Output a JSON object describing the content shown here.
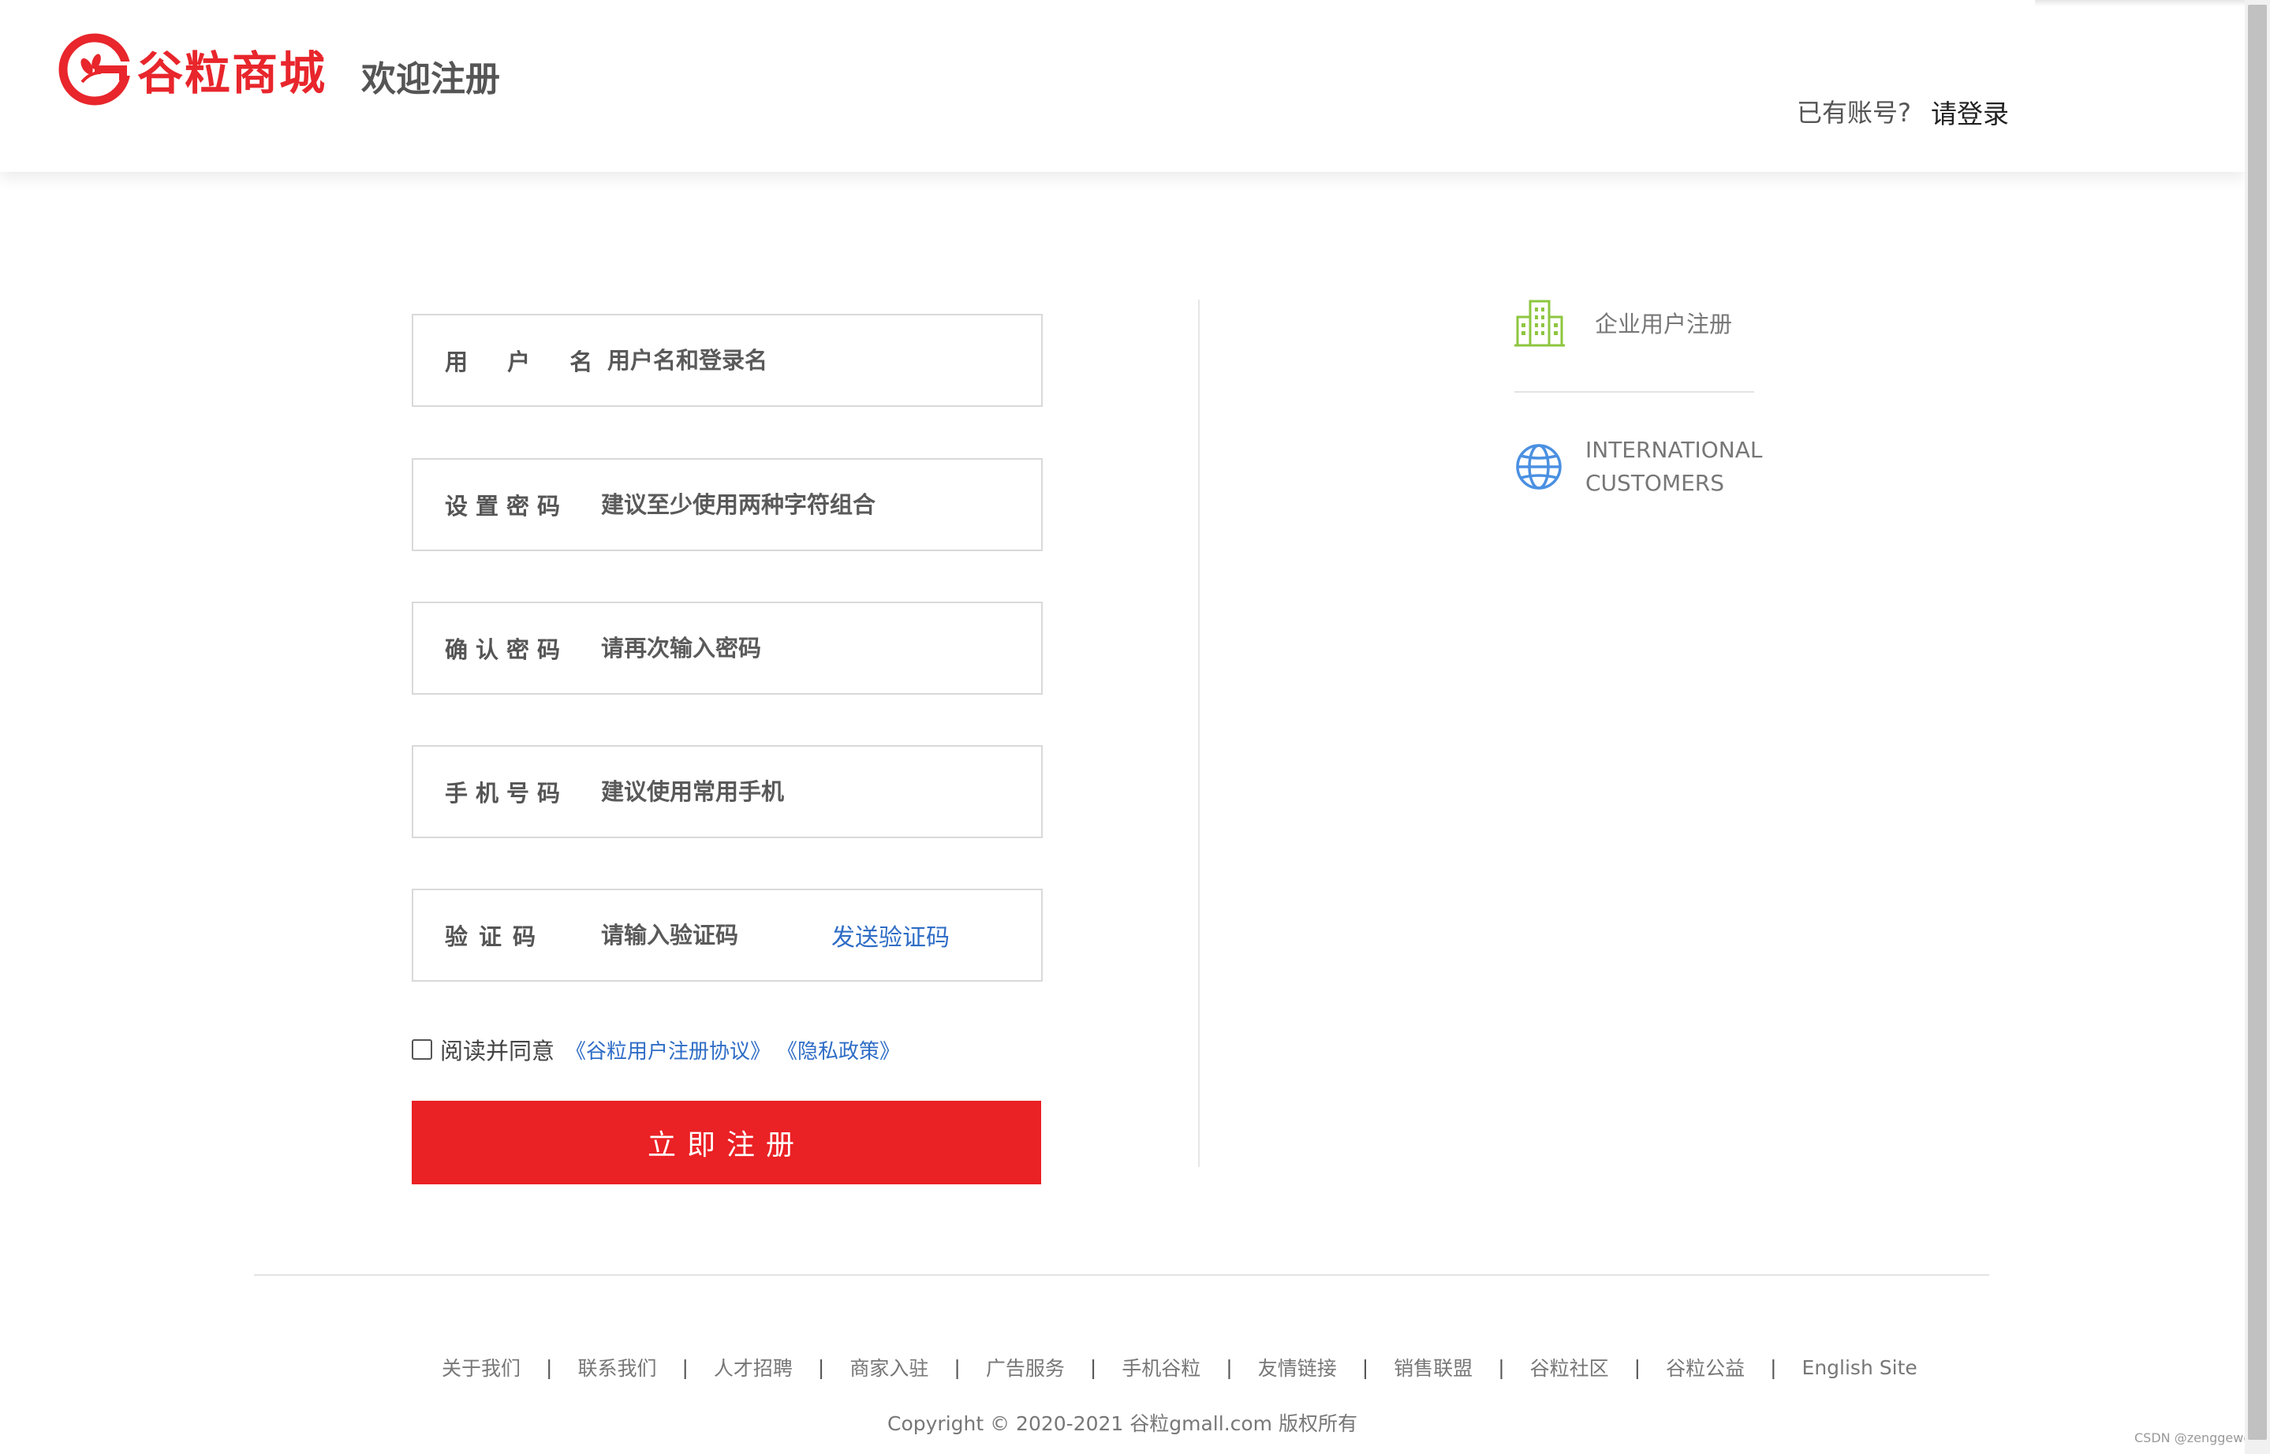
{
  "header": {
    "logo_text": "谷粒商城",
    "welcome": "欢迎注册",
    "login_hint": "已有账号?",
    "login_link": "请登录"
  },
  "form": {
    "fields": [
      {
        "label": "用 户 名",
        "placeholder": "用户名和登录名"
      },
      {
        "label": "设置密码",
        "placeholder": "建议至少使用两种字符组合"
      },
      {
        "label": "确认密码",
        "placeholder": "请再次输入密码"
      },
      {
        "label": "手机号码",
        "placeholder": "建议使用常用手机"
      },
      {
        "label": "验证码",
        "placeholder": "请输入验证码",
        "action": "发送验证码"
      }
    ],
    "agree_text": "阅读并同意",
    "agree_link_1": "《谷粒用户注册协议》",
    "agree_link_2": "《隐私政策》",
    "submit_label": "立即注册"
  },
  "side": {
    "enterprise_label": "企业用户注册",
    "intl_label_line1": "INTERNATIONAL",
    "intl_label_line2": "CUSTOMERS"
  },
  "footer": {
    "links": [
      "关于我们",
      "联系我们",
      "人才招聘",
      "商家入驻",
      "广告服务",
      "手机谷粒",
      "友情链接",
      "销售联盟",
      "谷粒社区",
      "谷粒公益",
      "English Site"
    ],
    "separator": "|",
    "copyright": "Copyright © 2020-2021 谷粒gmall.com 版权所有",
    "watermark": "CSDN @zenggeweis"
  },
  "colors": {
    "brand_red": "#ea2125",
    "link_blue": "#2f6dc6",
    "building_green": "#8ec63f",
    "globe_blue": "#4a90e2"
  }
}
